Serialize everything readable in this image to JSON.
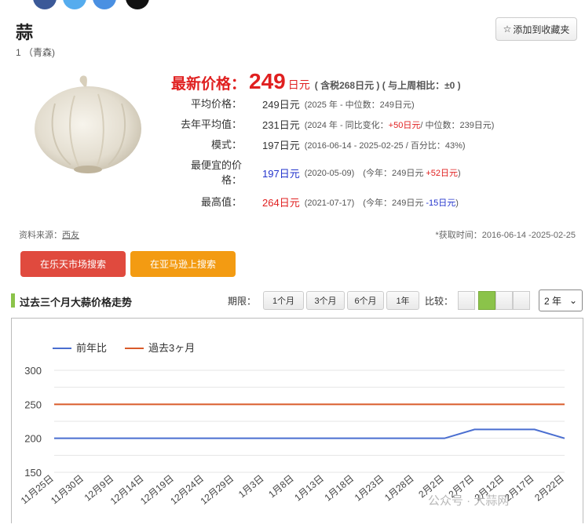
{
  "product": {
    "name": "蒜",
    "sub": "1 （青森)"
  },
  "favorite_label": "添加到收藏夹",
  "price": {
    "label": "最新价格：",
    "value": "249",
    "unit": "日元",
    "tax_note": "( 含税268日元 ) ( 与上周相比：±0 )"
  },
  "stats": [
    {
      "label": "平均价格：",
      "value": "249日元",
      "note": "(2025 年 - 中位数：249日元)"
    },
    {
      "label": "去年平均值：",
      "value": "231日元",
      "note_pre": "(2024 年 - 同比变化：",
      "note_red": "+50日元",
      "note_post": "/ 中位数：239日元)"
    },
    {
      "label": "模式：",
      "value": "197日元",
      "note": "(2016-06-14 - 2025-02-25 / 百分比：43%)"
    },
    {
      "label_line1": "最便宜的价",
      "label_line2": "格：",
      "value": "197日元",
      "note_pre": "(2020-05-09)　(今年：249日元 ",
      "note_red": "+52日元",
      "note_post": ")"
    },
    {
      "label": "最高值：",
      "value": "264日元",
      "note_pre": "(2021-07-17)　(今年：249日元 ",
      "note_blue": "-15日元",
      "note_post": ")"
    }
  ],
  "source_label": "资料来源：",
  "source_link": "西友",
  "fetch_time": "*获取时间：2016-06-14 -2025-02-25",
  "buttons": {
    "rakuten": "在乐天市场搜索",
    "amazon": "在亚马逊上搜索"
  },
  "section_title": "过去三个月大蒜价格走势",
  "period": {
    "label": "期限：",
    "options": [
      "1个月",
      "3个月",
      "6个月",
      "1年"
    ]
  },
  "compare_label": "比较：",
  "year_select": "2 年",
  "watermark": "公众号 · 大蒜网",
  "colors": {
    "red": "#e02020",
    "series_prev_year": "#4a6ed0",
    "series_3month": "#d95b2a",
    "accent_green": "#8bc34a"
  },
  "chart_data": {
    "type": "line",
    "x": [
      "11月25日",
      "11月30日",
      "12月9日",
      "12月14日",
      "12月19日",
      "12月24日",
      "12月29日",
      "1月3日",
      "1月8日",
      "1月13日",
      "1月18日",
      "1月23日",
      "1月28日",
      "2月2日",
      "2月7日",
      "2月12日",
      "2月17日",
      "2月22日"
    ],
    "series": [
      {
        "name": "前年比",
        "color": "#4a6ed0",
        "values": [
          200,
          200,
          200,
          200,
          200,
          200,
          200,
          200,
          200,
          200,
          200,
          200,
          200,
          200,
          213,
          213,
          213,
          200
        ]
      },
      {
        "name": "過去3ヶ月",
        "color": "#d95b2a",
        "values": [
          250,
          250,
          250,
          250,
          250,
          250,
          250,
          250,
          250,
          250,
          250,
          250,
          250,
          250,
          250,
          250,
          250,
          250
        ]
      }
    ],
    "ylim": [
      150,
      300
    ],
    "yticks": [
      150,
      200,
      250,
      300
    ],
    "grid": true,
    "legend_position": "top-left"
  }
}
